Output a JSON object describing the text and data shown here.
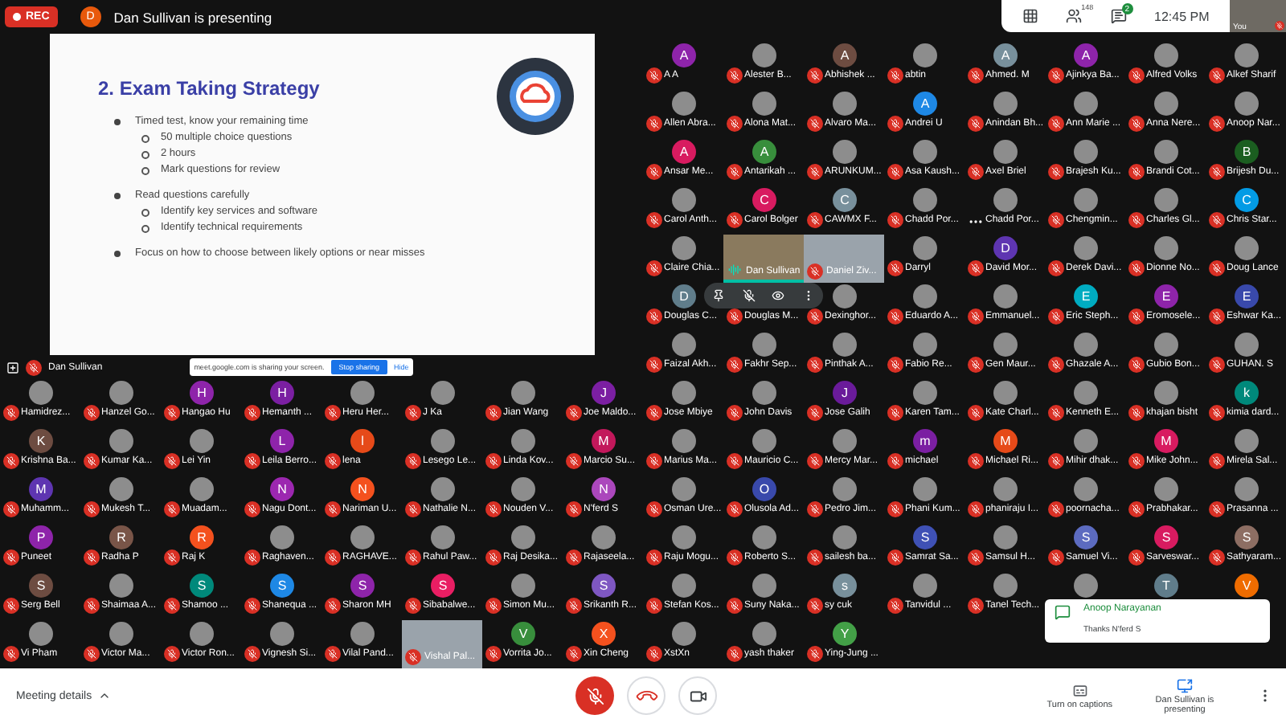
{
  "header": {
    "rec_label": "REC",
    "presenter_initial": "D",
    "presenter_text": "Dan Sullivan is presenting"
  },
  "top_panel": {
    "people_count": "148",
    "chat_badge": "2",
    "time": "12:45 PM",
    "self_label": "You"
  },
  "slide": {
    "title": "2. Exam Taking Strategy",
    "bullets": [
      {
        "text": "Timed test, know your remaining time",
        "children": [
          {
            "text": "50 multiple choice questions"
          },
          {
            "text": "2 hours"
          },
          {
            "text": "Mark questions for review"
          }
        ]
      },
      {
        "text": "Read questions carefully",
        "children": [
          {
            "text": "Identify key services and software"
          },
          {
            "text": "Identify technical requirements"
          }
        ]
      },
      {
        "text": "Focus on how to choose between likely options or near misses"
      }
    ]
  },
  "presentation_footer": {
    "name": "Dan Sullivan",
    "share_message": "meet.google.com is sharing your screen.",
    "stop_button": "Stop sharing",
    "hide_link": "Hide"
  },
  "top_grid": {
    "tiles": [
      {
        "name": "A A",
        "kind": "letter",
        "letter": "A",
        "color": "#8e24aa"
      },
      {
        "name": "Alester B...",
        "kind": "photo"
      },
      {
        "name": "Abhishek ...",
        "kind": "letter",
        "letter": "A",
        "color": "#6d4c41"
      },
      {
        "name": "abtin",
        "kind": "photo"
      },
      {
        "name": "Ahmed. M",
        "kind": "letter",
        "letter": "A",
        "color": "#78909c"
      },
      {
        "name": "Ajinkya Ba...",
        "kind": "letter",
        "letter": "A",
        "color": "#8e24aa"
      },
      {
        "name": "Alfred Volks",
        "kind": "photo"
      },
      {
        "name": "Alkef Sharif",
        "kind": "photo"
      },
      {
        "name": "Allen Abra...",
        "kind": "photo"
      },
      {
        "name": "Alona Mat...",
        "kind": "photo"
      },
      {
        "name": "Alvaro Ma...",
        "kind": "photo"
      },
      {
        "name": "Andrei U",
        "kind": "letter",
        "letter": "A",
        "color": "#1e88e5"
      },
      {
        "name": "Anindan Bh...",
        "kind": "photo"
      },
      {
        "name": "Ann Marie ...",
        "kind": "photo"
      },
      {
        "name": "Anna Nere...",
        "kind": "photo"
      },
      {
        "name": "Anoop Nar...",
        "kind": "photo"
      },
      {
        "name": "Ansar Me...",
        "kind": "letter",
        "letter": "A",
        "color": "#d81b60"
      },
      {
        "name": "Antarikah ...",
        "kind": "letter",
        "letter": "A",
        "color": "#388e3c"
      },
      {
        "name": "ARUNKUM...",
        "kind": "photo"
      },
      {
        "name": "Asa Kaush...",
        "kind": "photo"
      },
      {
        "name": "Axel Briel",
        "kind": "photo"
      },
      {
        "name": "Brajesh Ku...",
        "kind": "photo"
      },
      {
        "name": "Brandi Cot...",
        "kind": "photo"
      },
      {
        "name": "Brijesh Du...",
        "kind": "letter",
        "letter": "B",
        "color": "#1b5e20"
      },
      {
        "name": "Carol Anth...",
        "kind": "photo"
      },
      {
        "name": "Carol Bolger",
        "kind": "letter",
        "letter": "C",
        "color": "#d81b60"
      },
      {
        "name": "CAWMX F...",
        "kind": "letter",
        "letter": "C",
        "color": "#78909c"
      },
      {
        "name": "Chadd Por...",
        "kind": "photo"
      },
      {
        "name": "Chadd Por...",
        "kind": "menu"
      },
      {
        "name": "Chengmin...",
        "kind": "photo"
      },
      {
        "name": "Charles Gl...",
        "kind": "photo"
      },
      {
        "name": "Chris Star...",
        "kind": "letter",
        "letter": "C",
        "color": "#039be5"
      },
      {
        "name": "Claire Chia...",
        "kind": "photo"
      },
      {
        "name": "Dan Sullivan",
        "kind": "video",
        "speaking": true
      },
      {
        "name": "Daniel Ziv...",
        "kind": "video",
        "speaking": false
      },
      {
        "name": "Darryl",
        "kind": "photo"
      },
      {
        "name": "David Mor...",
        "kind": "letter",
        "letter": "D",
        "color": "#5e35b1"
      },
      {
        "name": "Derek Davi...",
        "kind": "photo"
      },
      {
        "name": "Dionne No...",
        "kind": "photo"
      },
      {
        "name": "Doug Lance",
        "kind": "photo"
      },
      {
        "name": "Douglas C...",
        "kind": "letter",
        "letter": "D",
        "color": "#607d8b"
      },
      {
        "name": "Douglas M...",
        "kind": "hovered"
      },
      {
        "name": "Dexinghor...",
        "kind": "photo"
      },
      {
        "name": "Eduardo A...",
        "kind": "photo"
      },
      {
        "name": "Emmanuel...",
        "kind": "photo"
      },
      {
        "name": "Eric Steph...",
        "kind": "letter",
        "letter": "E",
        "color": "#00acc1"
      },
      {
        "name": "Eromosele...",
        "kind": "letter",
        "letter": "E",
        "color": "#8e24aa"
      },
      {
        "name": "Eshwar Ka...",
        "kind": "letter",
        "letter": "E",
        "color": "#3949ab"
      },
      {
        "name": "Faizal Akh...",
        "kind": "photo"
      },
      {
        "name": "Fakhr Sep...",
        "kind": "photo"
      },
      {
        "name": "Pinthak A...",
        "kind": "photo"
      },
      {
        "name": "Fabio Re...",
        "kind": "photo"
      },
      {
        "name": "Gen Maur...",
        "kind": "photo"
      },
      {
        "name": "Ghazale A...",
        "kind": "photo"
      },
      {
        "name": "Gubio Bon...",
        "kind": "photo"
      },
      {
        "name": "GUHAN. S",
        "kind": "photo"
      }
    ]
  },
  "bottom_grid": {
    "tiles": [
      {
        "name": "Hamidrez...",
        "kind": "photo"
      },
      {
        "name": "Hanzel Go...",
        "kind": "photo"
      },
      {
        "name": "Hangao Hu",
        "kind": "letter",
        "letter": "H",
        "color": "#8e24aa"
      },
      {
        "name": "Hemanth ...",
        "kind": "letter",
        "letter": "H",
        "color": "#7b1fa2"
      },
      {
        "name": "Heru Her...",
        "kind": "photo"
      },
      {
        "name": "J Ka",
        "kind": "photo"
      },
      {
        "name": "Jian Wang",
        "kind": "photo"
      },
      {
        "name": "Joe Maldo...",
        "kind": "letter",
        "letter": "J",
        "color": "#7b1fa2"
      },
      {
        "name": "Jose Mbiye",
        "kind": "photo"
      },
      {
        "name": "John Davis",
        "kind": "photo"
      },
      {
        "name": "Jose Galih",
        "kind": "letter",
        "letter": "J",
        "color": "#6a1b9a"
      },
      {
        "name": "Karen Tam...",
        "kind": "photo"
      },
      {
        "name": "Kate Charl...",
        "kind": "photo"
      },
      {
        "name": "Kenneth E...",
        "kind": "photo"
      },
      {
        "name": "khajan bisht",
        "kind": "photo"
      },
      {
        "name": "kimia dard...",
        "kind": "letter",
        "letter": "k",
        "color": "#00897b"
      },
      {
        "name": "Krishna Ba...",
        "kind": "letter",
        "letter": "K",
        "color": "#6d4c41"
      },
      {
        "name": "Kumar Ka...",
        "kind": "photo"
      },
      {
        "name": "Lei Yin",
        "kind": "photo"
      },
      {
        "name": "Leila Berro...",
        "kind": "letter",
        "letter": "L",
        "color": "#8e24aa"
      },
      {
        "name": "lena",
        "kind": "letter",
        "letter": "l",
        "color": "#e64a19"
      },
      {
        "name": "Lesego Le...",
        "kind": "photo"
      },
      {
        "name": "Linda Kov...",
        "kind": "photo"
      },
      {
        "name": "Marcio Su...",
        "kind": "letter",
        "letter": "M",
        "color": "#c2185b"
      },
      {
        "name": "Marius Ma...",
        "kind": "photo"
      },
      {
        "name": "Mauricio C...",
        "kind": "photo"
      },
      {
        "name": "Mercy Mar...",
        "kind": "photo"
      },
      {
        "name": "michael",
        "kind": "letter",
        "letter": "m",
        "color": "#7b1fa2"
      },
      {
        "name": "Michael Ri...",
        "kind": "letter",
        "letter": "M",
        "color": "#e64a19"
      },
      {
        "name": "Mihir dhak...",
        "kind": "photo"
      },
      {
        "name": "Mike John...",
        "kind": "letter",
        "letter": "M",
        "color": "#d81b60"
      },
      {
        "name": "Mirela Sal...",
        "kind": "photo"
      },
      {
        "name": "Muhamm...",
        "kind": "letter",
        "letter": "M",
        "color": "#5e35b1"
      },
      {
        "name": "Mukesh T...",
        "kind": "photo"
      },
      {
        "name": "Muadam...",
        "kind": "photo"
      },
      {
        "name": "Nagu Dont...",
        "kind": "letter",
        "letter": "N",
        "color": "#9c27b0"
      },
      {
        "name": "Nariman U...",
        "kind": "letter",
        "letter": "N",
        "color": "#f4511e"
      },
      {
        "name": "Nathalie N...",
        "kind": "photo"
      },
      {
        "name": "Nouden V...",
        "kind": "photo"
      },
      {
        "name": "N'ferd S",
        "kind": "letter",
        "letter": "N",
        "color": "#ab47bc"
      },
      {
        "name": "Osman Ure...",
        "kind": "photo"
      },
      {
        "name": "Olusola Ad...",
        "kind": "letter",
        "letter": "O",
        "color": "#3949ab"
      },
      {
        "name": "Pedro Jim...",
        "kind": "photo"
      },
      {
        "name": "Phani Kum...",
        "kind": "photo"
      },
      {
        "name": "phaniraju I...",
        "kind": "photo"
      },
      {
        "name": "poornacha...",
        "kind": "photo"
      },
      {
        "name": "Prabhakar...",
        "kind": "photo"
      },
      {
        "name": "Prasanna ...",
        "kind": "photo"
      },
      {
        "name": "Puneet",
        "kind": "letter",
        "letter": "P",
        "color": "#8e24aa"
      },
      {
        "name": "Radha P",
        "kind": "letter",
        "letter": "R",
        "color": "#795548"
      },
      {
        "name": "Raj K",
        "kind": "letter",
        "letter": "R",
        "color": "#f4511e"
      },
      {
        "name": "Raghaven...",
        "kind": "photo"
      },
      {
        "name": "RAGHAVE...",
        "kind": "photo"
      },
      {
        "name": "Rahul Paw...",
        "kind": "photo"
      },
      {
        "name": "Raj Desika...",
        "kind": "photo"
      },
      {
        "name": "Rajaseela...",
        "kind": "photo"
      },
      {
        "name": "Raju Mogu...",
        "kind": "photo"
      },
      {
        "name": "Roberto S...",
        "kind": "photo"
      },
      {
        "name": "sailesh ba...",
        "kind": "photo"
      },
      {
        "name": "Samrat Sa...",
        "kind": "letter",
        "letter": "S",
        "color": "#3f51b5"
      },
      {
        "name": "Samsul H...",
        "kind": "photo"
      },
      {
        "name": "Samuel Vi...",
        "kind": "letter",
        "letter": "S",
        "color": "#5c6bc0"
      },
      {
        "name": "Sarveswar...",
        "kind": "letter",
        "letter": "S",
        "color": "#d81b60"
      },
      {
        "name": "Sathyaram...",
        "kind": "letter",
        "letter": "S",
        "color": "#8d6e63"
      },
      {
        "name": "Serg Bell",
        "kind": "letter",
        "letter": "S",
        "color": "#6d4c41"
      },
      {
        "name": "Shaimaa A...",
        "kind": "photo"
      },
      {
        "name": "Shamoo ...",
        "kind": "letter",
        "letter": "S",
        "color": "#00897b"
      },
      {
        "name": "Shanequa ...",
        "kind": "letter",
        "letter": "S",
        "color": "#1e88e5"
      },
      {
        "name": "Sharon MH",
        "kind": "letter",
        "letter": "S",
        "color": "#8e24aa"
      },
      {
        "name": "Sibabalwe...",
        "kind": "letter",
        "letter": "S",
        "color": "#e91e63"
      },
      {
        "name": "Simon Mu...",
        "kind": "photo"
      },
      {
        "name": "Srikanth R...",
        "kind": "letter",
        "letter": "S",
        "color": "#7e57c2"
      },
      {
        "name": "Stefan Kos...",
        "kind": "photo"
      },
      {
        "name": "Suny Naka...",
        "kind": "photo"
      },
      {
        "name": "sy cuk",
        "kind": "letter",
        "letter": "s",
        "color": "#78909c"
      },
      {
        "name": "Tanvidul ...",
        "kind": "photo"
      },
      {
        "name": "Tanel Tech...",
        "kind": "photo"
      },
      {
        "kind": "photo"
      },
      {
        "kind": "letter",
        "letter": "T",
        "color": "#607d8b"
      },
      {
        "kind": "letter",
        "letter": "V",
        "color": "#ef6c00"
      },
      {
        "name": "Vi Pham",
        "kind": "photo"
      },
      {
        "name": "Victor Ma...",
        "kind": "photo"
      },
      {
        "name": "Victor Ron...",
        "kind": "photo"
      },
      {
        "name": "Vignesh Si...",
        "kind": "photo"
      },
      {
        "name": "Vilal Pand...",
        "kind": "photo"
      },
      {
        "name": "Vishal Pal...",
        "kind": "video",
        "speaking": false
      },
      {
        "name": "Vorrita Jo...",
        "kind": "letter",
        "letter": "V",
        "color": "#388e3c"
      },
      {
        "name": "Xin Cheng",
        "kind": "letter",
        "letter": "X",
        "color": "#f4511e"
      },
      {
        "name": "XstXn",
        "kind": "photo"
      },
      {
        "name": "yash thaker",
        "kind": "photo"
      },
      {
        "name": "Ying-Jung ...",
        "kind": "letter",
        "letter": "Y",
        "color": "#43a047"
      }
    ]
  },
  "notification": {
    "sender": "Anoop Narayanan",
    "message": "Thanks N'ferd S"
  },
  "bottom_bar": {
    "meeting_details": "Meeting details",
    "captions_label": "Turn on captions",
    "presenting_label": "Dan Sullivan is presenting"
  }
}
